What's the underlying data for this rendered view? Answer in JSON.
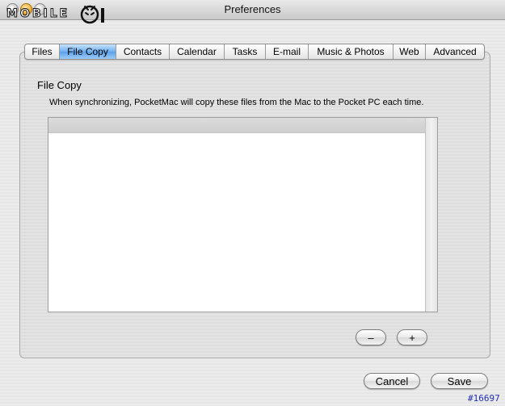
{
  "window": {
    "title": "Preferences",
    "logo_text": "MOBILE"
  },
  "tabs": [
    {
      "label": "Files",
      "selected": false
    },
    {
      "label": "File Copy",
      "selected": true
    },
    {
      "label": "Contacts",
      "selected": false
    },
    {
      "label": "Calendar",
      "selected": false
    },
    {
      "label": "Tasks",
      "selected": false
    },
    {
      "label": "E-mail",
      "selected": false
    },
    {
      "label": "Music & Photos",
      "selected": false
    },
    {
      "label": "Web",
      "selected": false
    },
    {
      "label": "Advanced",
      "selected": false
    }
  ],
  "section": {
    "title": "File Copy",
    "description": "When synchronizing, PocketMac will copy these files from the Mac to the Pocket PC each time."
  },
  "file_list": {
    "items": []
  },
  "list_buttons": {
    "remove_label": "–",
    "add_label": "+"
  },
  "footer": {
    "cancel_label": "Cancel",
    "save_label": "Save"
  },
  "watermark": "#16697",
  "colors": {
    "selected_tab": "#6fb0f0",
    "watermark": "#1f2fb0"
  }
}
